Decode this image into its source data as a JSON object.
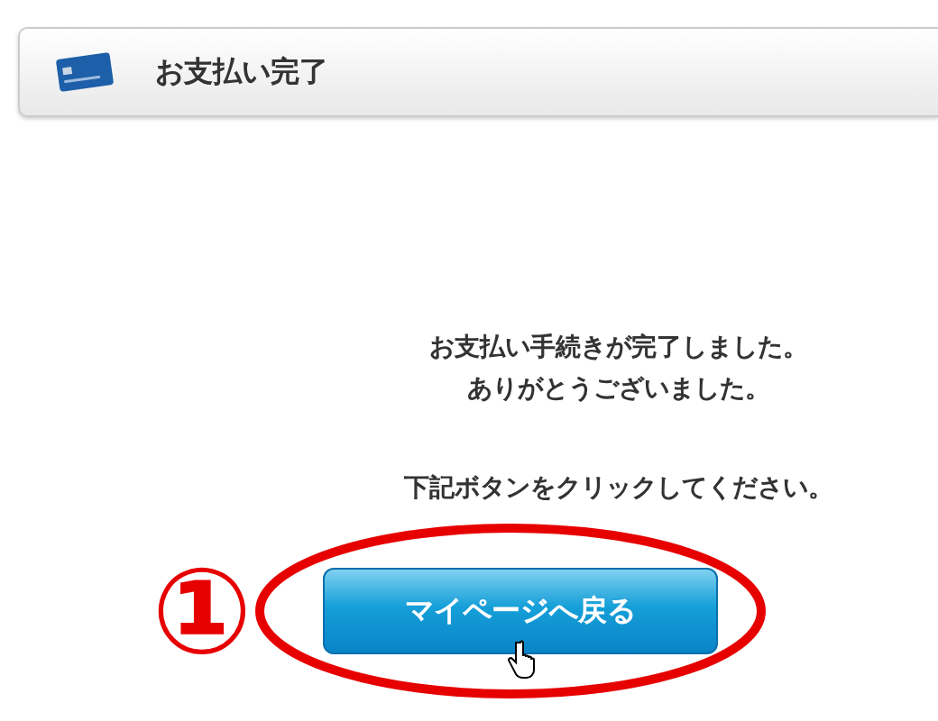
{
  "header": {
    "title": "お支払い完了"
  },
  "message": {
    "lines": [
      "お支払い手続きが完了しました。",
      "ありがとうございました。"
    ],
    "instruction": "下記ボタンをクリックしてください。"
  },
  "annotation": {
    "marker": "①"
  },
  "button": {
    "label": "マイページへ戻る"
  }
}
